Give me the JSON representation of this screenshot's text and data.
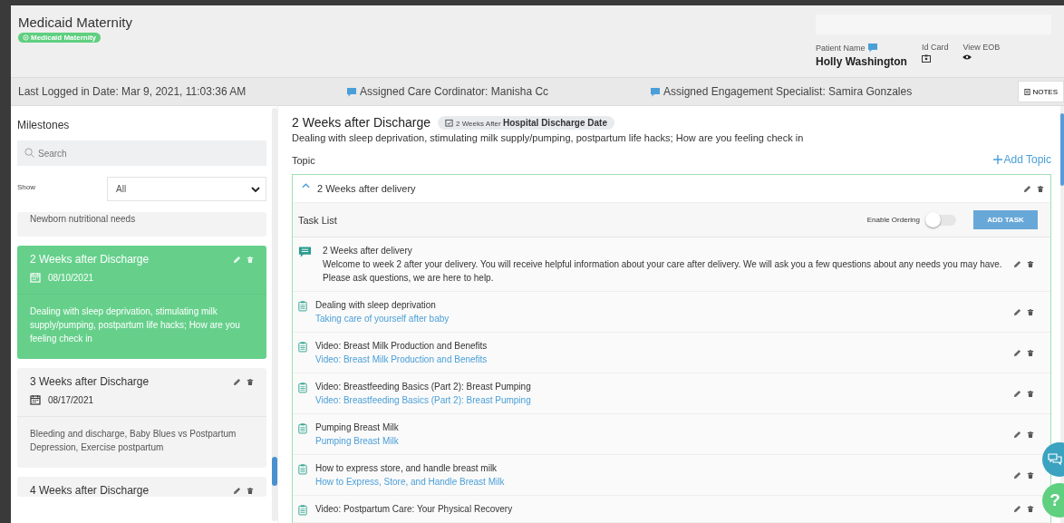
{
  "header": {
    "title": "Medicaid Maternity",
    "program_badge": "Medicaid Maternity",
    "patient_name_label": "Patient Name",
    "patient_name": "Holly Washington",
    "id_card_label": "Id Card",
    "view_eob_label": "View EOB"
  },
  "info_bar": {
    "last_logged": "Last Logged in Date: Mar 9, 2021, 11:03:36 AM",
    "care_coordinator": "Assigned Care Cordinator: Manisha Cc",
    "engagement_specialist": "Assigned Engagement Specialist: Samira Gonzales",
    "notes_button": "NOTES"
  },
  "sidebar": {
    "title": "Milestones",
    "search": {
      "placeholder": "Search"
    },
    "show_label": "Show",
    "show_value": "All",
    "milestones": [
      {
        "description": "Newborn nutritional needs",
        "selected": false
      },
      {
        "title": "2 Weeks after Discharge",
        "date": "08/10/2021",
        "description": "Dealing with sleep deprivation, stimulating milk supply/pumping, postpartum life hacks; How are you feeling check in",
        "selected": true
      },
      {
        "title": "3 Weeks after Discharge",
        "date": "08/17/2021",
        "description": "Bleeding and discharge, Baby Blues vs Postpartum Depression, Exercise postpartum",
        "selected": false
      },
      {
        "title": "4 Weeks after Discharge",
        "selected": false
      }
    ]
  },
  "detail": {
    "title": "2 Weeks after Discharge",
    "schedule_badge": "2 Weeks After **Hospital Discharge Date**",
    "description": "Dealing with sleep deprivation, stimulating milk supply/pumping, postpartum life hacks; How are you feeling check in",
    "topic_label": "Topic",
    "add_topic": "Add Topic",
    "topic": {
      "title": "2 Weeks after delivery",
      "expanded": true,
      "task_list_label": "Task List",
      "enable_ordering_label": "Enable Ordering",
      "enable_ordering": false,
      "add_task": "ADD TASK",
      "tasks": [
        {
          "kind": "message",
          "title": "2 Weeks after delivery",
          "body": "Welcome to week 2 after your delivery. You will receive helpful information about your care after delivery. We will ask you a few questions about any needs you may have. Please ask questions, we are here to help."
        },
        {
          "kind": "task",
          "title": "Dealing with sleep deprivation",
          "link": "Taking care of yourself after baby"
        },
        {
          "kind": "task",
          "title": "Video: Breast Milk Production and Benefits",
          "link": "Video: Breast Milk Production and Benefits"
        },
        {
          "kind": "task",
          "title": "Video: Breastfeeding Basics (Part 2): Breast Pumping",
          "link": "Video: Breastfeeding Basics (Part 2): Breast Pumping"
        },
        {
          "kind": "task",
          "title": "Pumping Breast Milk",
          "link": "Pumping Breast Milk"
        },
        {
          "kind": "task",
          "title": "How to express store, and handle breast milk",
          "link": "How to Express, Store, and Handle Breast Milk"
        },
        {
          "kind": "task",
          "title": "Video: Postpartum Care: Your Physical Recovery"
        }
      ]
    }
  },
  "help_button": "?"
}
